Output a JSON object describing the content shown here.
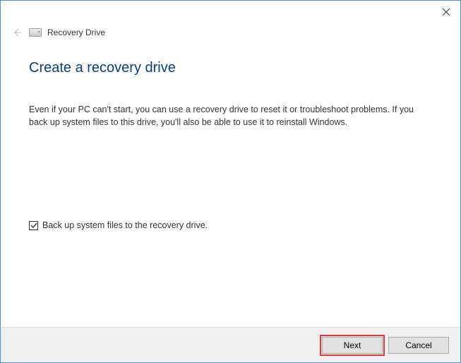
{
  "window": {
    "title": "Recovery Drive"
  },
  "main": {
    "heading": "Create a recovery drive",
    "body": "Even if your PC can't start, you can use a recovery drive to reset it or troubleshoot problems. If you back up system files to this drive, you'll also be able to use it to reinstall Windows."
  },
  "checkbox": {
    "label": "Back up system files to the recovery drive.",
    "checked": true
  },
  "footer": {
    "next_label": "Next",
    "cancel_label": "Cancel"
  }
}
